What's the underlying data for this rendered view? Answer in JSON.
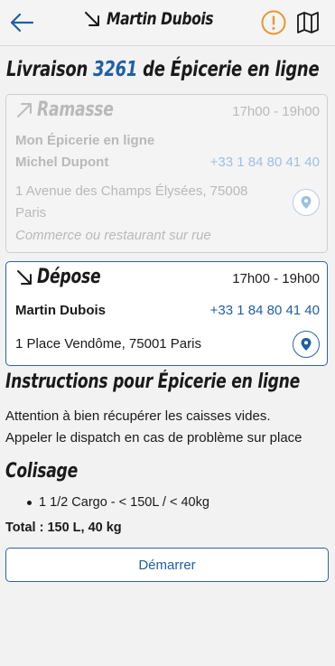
{
  "header": {
    "title": "Martin Dubois",
    "back_icon": "arrow-left-icon",
    "alert_icon": "exclamation-circle-icon",
    "map_icon": "map-icon"
  },
  "delivery": {
    "label_prefix": "Livraison",
    "number": "3261",
    "label_suffix": "de Épicerie en ligne"
  },
  "pickup": {
    "title": "Ramasse",
    "time": "17h00 - 19h00",
    "company": "Mon Épicerie en ligne",
    "contact": "Michel Dupont",
    "phone": "+33 1 84 80 41 40",
    "address_line1": "1 Avenue des Champs Élysées, 75008",
    "address_line2": "Paris",
    "place_type": "Commerce ou restaurant sur rue"
  },
  "dropoff": {
    "title": "Dépose",
    "time": "17h00 - 19h00",
    "contact": "Martin Dubois",
    "phone": "+33 1 84 80 41 40",
    "address": "1 Place Vendôme, 75001 Paris"
  },
  "instructions": {
    "title": "Instructions pour Épicerie en ligne",
    "line1": "Attention à bien récupérer les caisses vides.",
    "line2": "Appeler le dispatch en cas de problème sur place"
  },
  "packaging": {
    "title": "Colisage",
    "items": [
      "1 1/2 Cargo - < 150L / < 40kg"
    ],
    "total": "Total : 150 L, 40 kg"
  },
  "actions": {
    "start_label": "Démarrer"
  },
  "colors": {
    "accent": "#1e5fa8",
    "warning": "#e8962e"
  }
}
